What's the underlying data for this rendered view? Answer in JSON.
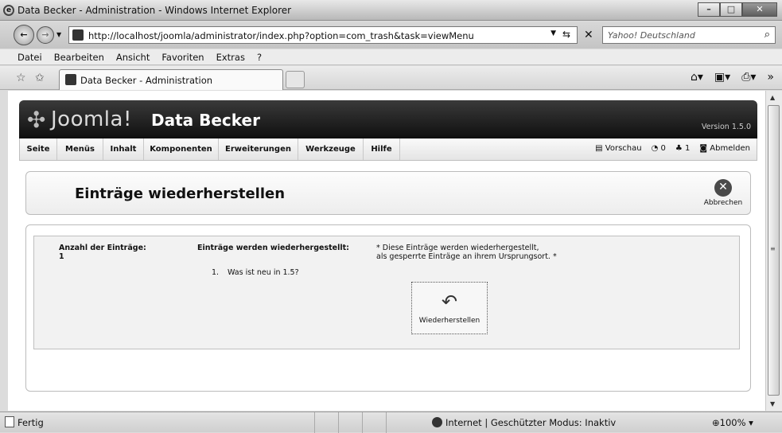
{
  "window": {
    "title": "Data Becker - Administration - Windows Internet Explorer",
    "minimize": "–",
    "maximize": "□",
    "close": "✕"
  },
  "address": {
    "url": "http://localhost/joomla/administrator/index.php?option=com_trash&task=viewMenu",
    "search_placeholder": "Yahoo! Deutschland"
  },
  "menubar": [
    "Datei",
    "Bearbeiten",
    "Ansicht",
    "Favoriten",
    "Extras",
    "?"
  ],
  "tab": {
    "label": "Data Becker - Administration"
  },
  "joomla": {
    "logo": "Joomla!",
    "site_name": "Data Becker",
    "version": "Version 1.5.0",
    "menu": [
      "Seite",
      "Menüs",
      "Inhalt",
      "Komponenten",
      "Erweiterungen",
      "Werkzeuge",
      "Hilfe"
    ],
    "preview": "Vorschau",
    "messages_count": "0",
    "users_count": "1",
    "logout": "Abmelden"
  },
  "toolbar": {
    "heading": "Einträge wiederherstellen",
    "cancel_label": "Abbrechen"
  },
  "content": {
    "count_label": "Anzahl der Einträge:",
    "count_value": "1",
    "restored_label": "Einträge werden wiederhergestellt:",
    "items": [
      {
        "num": "1.",
        "title": "Was ist neu in 1.5?"
      }
    ],
    "note_line1": "* Diese Einträge werden wiederhergestellt,",
    "note_line2": "als gesperrte Einträge an ihrem Ursprungsort. *",
    "restore_button": "Wiederherstellen"
  },
  "status": {
    "left": "Fertig",
    "zone": "Internet | Geschützter Modus: Inaktiv",
    "zoom": "100%"
  }
}
